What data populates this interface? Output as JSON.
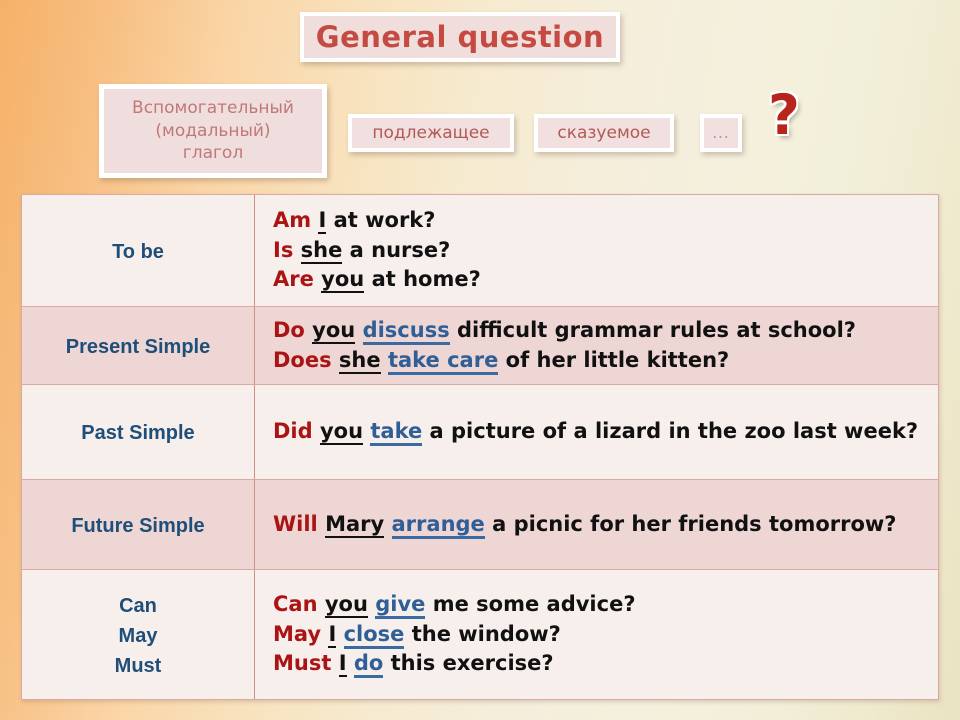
{
  "title": {
    "text": "General question"
  },
  "legend": {
    "aux_lines": [
      "Вспомогательный",
      "(модальный)",
      "глагол"
    ],
    "subject": "подлежащее",
    "predicate": "сказуемое",
    "ellipsis": "...",
    "question_mark": "?"
  },
  "colors": {
    "auxiliary": "#aa1414",
    "predicate": "#2f5f96",
    "label": "#1f4e79",
    "title": "#c44a42",
    "row_light": "#f7efec",
    "row_dark": "#eed6d4"
  },
  "table": {
    "rows": [
      {
        "label": [
          "To be"
        ],
        "sentences": [
          {
            "aux": "Am",
            "subject": "I",
            "predicate": "",
            "rest": "at work?"
          },
          {
            "aux": "Is",
            "subject": "she",
            "predicate": "",
            "rest": "a nurse?"
          },
          {
            "aux": "Are",
            "subject": "you",
            "predicate": "",
            "rest": "at home?"
          }
        ]
      },
      {
        "label": [
          "Present Simple"
        ],
        "sentences": [
          {
            "aux": "Do",
            "subject": "you",
            "predicate": "discuss",
            "rest": "difficult grammar rules at school?"
          },
          {
            "aux": "Does",
            "subject": "she",
            "predicate": "take care",
            "rest": "of her little kitten?"
          }
        ]
      },
      {
        "label": [
          "Past Simple"
        ],
        "sentences": [
          {
            "aux": "Did",
            "subject": "you",
            "predicate": "take",
            "rest": "a picture of a lizard in the zoo last week?"
          }
        ]
      },
      {
        "label": [
          "Future Simple"
        ],
        "sentences": [
          {
            "aux": "Will",
            "subject": "Mary",
            "predicate": "arrange",
            "rest": "a picnic for her friends tomorrow?"
          }
        ]
      },
      {
        "label": [
          "Can",
          "May",
          "Must"
        ],
        "sentences": [
          {
            "aux": "Can",
            "subject": "you",
            "predicate": "give",
            "rest": "me some advice?"
          },
          {
            "aux": "May",
            "subject": "I",
            "predicate": "close",
            "rest": "the window?"
          },
          {
            "aux": "Must",
            "subject": "I",
            "predicate": "do",
            "rest": "this exercise?"
          }
        ]
      }
    ]
  }
}
